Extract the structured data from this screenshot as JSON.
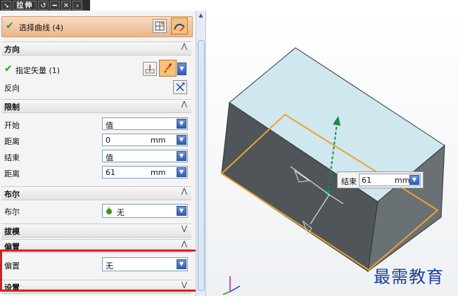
{
  "titlebar": {
    "title": "拉伸"
  },
  "select_curve": {
    "label": "选择曲线 (4)"
  },
  "direction": {
    "header": "方向",
    "vector_label": "指定矢量 (1)",
    "reverse_label": "反向"
  },
  "limits": {
    "header": "限制",
    "start_label": "开始",
    "start_value": "值",
    "distance1_label": "距离",
    "distance1_value": "0",
    "distance1_unit": "mm",
    "end_label": "结束",
    "end_value": "值",
    "distance2_label": "距离",
    "distance2_value": "61",
    "distance2_unit": "mm"
  },
  "boolean": {
    "header": "布尔",
    "label": "布尔",
    "value": "无"
  },
  "draft": {
    "header": "拔模"
  },
  "offset": {
    "header": "偏置",
    "label": "偏置",
    "value": "无"
  },
  "settings": {
    "header": "设置"
  },
  "viewport": {
    "tooltip_label": "结束",
    "tooltip_value": "61",
    "tooltip_unit": "mm",
    "watermark": "最需教育"
  },
  "colors": {
    "highlight": "#d62020",
    "top_face": "#cfe7ee",
    "front_face": "#4f5558",
    "side_face": "#6a7175",
    "outline": "#f0a030",
    "handle": "#1a8a4a"
  }
}
